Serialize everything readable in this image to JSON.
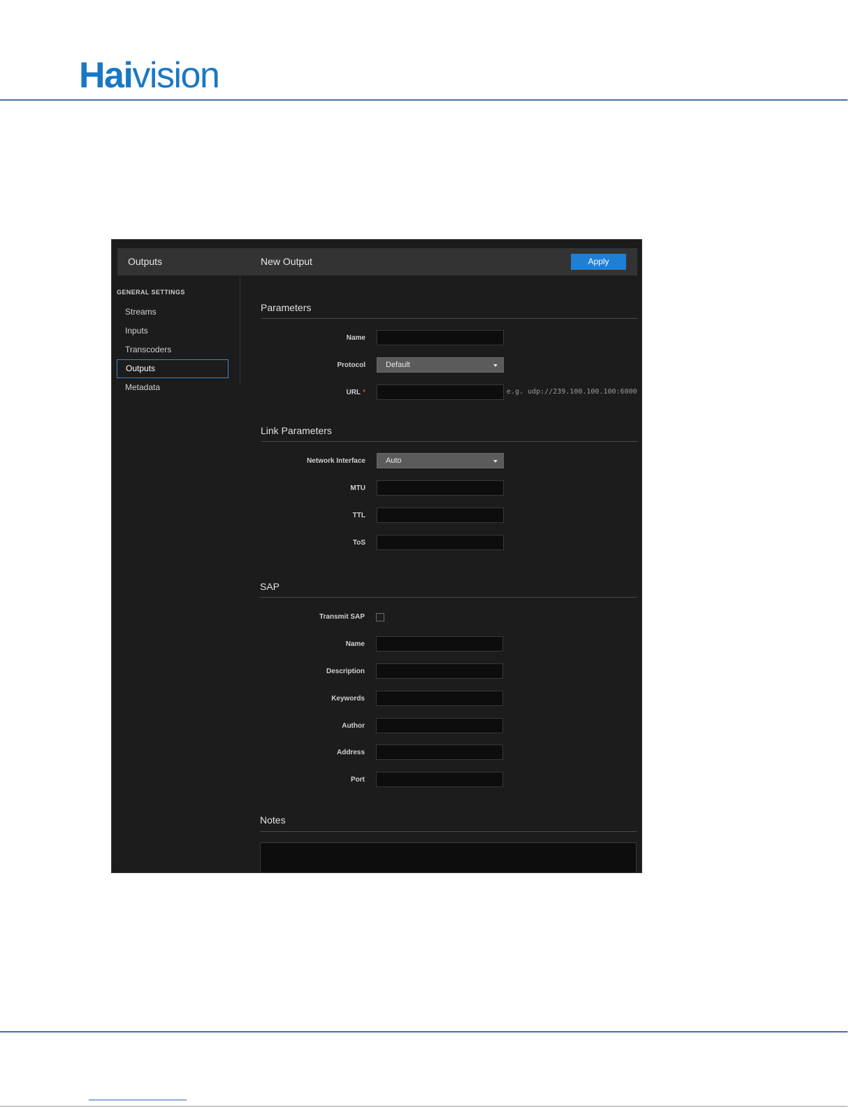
{
  "document": {
    "logo_bold": "Hai",
    "logo_regular": "vision"
  },
  "app": {
    "header": {
      "section": "Outputs",
      "title": "New Output",
      "apply_label": "Apply"
    },
    "sidebar": {
      "heading": "GENERAL SETTINGS",
      "items": [
        {
          "label": "Streams",
          "active": false
        },
        {
          "label": "Inputs",
          "active": false
        },
        {
          "label": "Transcoders",
          "active": false
        },
        {
          "label": "Outputs",
          "active": true
        },
        {
          "label": "Metadata",
          "active": false
        }
      ]
    },
    "parameters": {
      "title": "Parameters",
      "name_label": "Name",
      "name_value": "",
      "protocol_label": "Protocol",
      "protocol_value": "Default",
      "url_label": "URL",
      "url_required": "*",
      "url_value": "",
      "url_hint": "e.g. udp://239.100.100.100:6000"
    },
    "link_parameters": {
      "title": "Link Parameters",
      "network_interface_label": "Network Interface",
      "network_interface_value": "Auto",
      "mtu_label": "MTU",
      "mtu_value": "",
      "ttl_label": "TTL",
      "ttl_value": "",
      "tos_label": "ToS",
      "tos_value": ""
    },
    "sap": {
      "title": "SAP",
      "transmit_label": "Transmit SAP",
      "transmit_checked": false,
      "name_label": "Name",
      "description_label": "Description",
      "keywords_label": "Keywords",
      "author_label": "Author",
      "address_label": "Address",
      "port_label": "Port"
    },
    "notes": {
      "title": "Notes",
      "value": ""
    },
    "colors": {
      "accent": "#1f7fd4",
      "background": "#1c1c1c",
      "header": "#333333",
      "brand": "#1a78c2"
    }
  }
}
